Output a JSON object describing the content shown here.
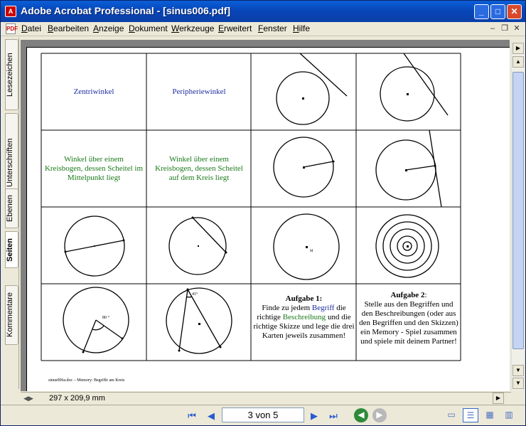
{
  "window": {
    "title": "Adobe Acrobat Professional - [sinus006.pdf]"
  },
  "menu": [
    "Datei",
    "Bearbeiten",
    "Anzeige",
    "Dokument",
    "Werkzeuge",
    "Erweitert",
    "Fenster",
    "Hilfe"
  ],
  "side_tabs": [
    "Lesezeichen",
    "Unterschriften",
    "Ebenen",
    "Seiten",
    "Kommentare"
  ],
  "page": {
    "cells": {
      "zentriwinkel": "Zentriwinkel",
      "peripheriewinkel": "Peripheriewinkel",
      "desc_zentri": "Winkel über einem Kreisbogen, dessen Scheitel im Mittelpunkt liegt",
      "desc_peri": "Winkel über einem Kreisbogen, dessen Scheitel auf dem Kreis liegt",
      "angle_80": "80 °",
      "angle_41": "41°",
      "label_m": "M"
    },
    "task1": {
      "title": "Aufgabe 1:",
      "part_a": "Finde zu jedem ",
      "word_begriff": "Begriff",
      "part_b": " die richtige ",
      "word_beschreibung": "Beschreibung",
      "part_c": " und die richtige Skizze und lege die drei Karten jeweils zusammen!"
    },
    "task2": {
      "title": "Aufgabe 2",
      "title_colon": ":",
      "body": "Stelle aus den Begriffen und den Beschreibungen (oder aus den Begriffen und den Skizzen) ein Memory - Spiel zusammen und spiele mit deinem Partner!"
    },
    "footer": "sinus006a.doc – Memory: Begriffe am Kreis"
  },
  "status": {
    "page_size": "297 x 209,9 mm"
  },
  "navigation": {
    "page_indicator": "3 von 5"
  },
  "colors": {
    "blue_text": "#1c2ca0",
    "green_text": "#1a7a1a",
    "title_bar": "#0a5fd8"
  }
}
